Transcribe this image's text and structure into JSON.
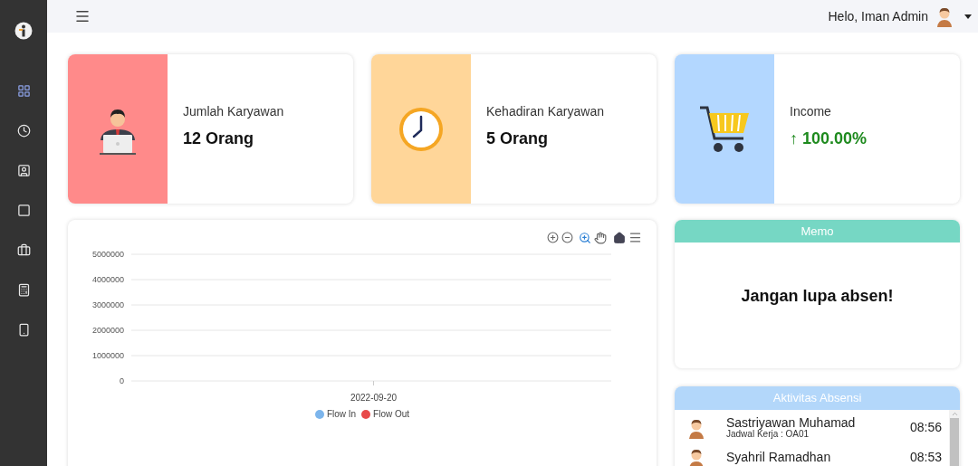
{
  "topbar": {
    "greeting": "Helo, Iman Admin"
  },
  "sidebar": {
    "items": [
      {
        "selected": true
      },
      {
        "selected": false
      },
      {
        "selected": false
      },
      {
        "selected": false
      },
      {
        "selected": false
      },
      {
        "selected": false
      },
      {
        "selected": false
      }
    ]
  },
  "stats": [
    {
      "kind": "employees",
      "label": "Jumlah Karyawan",
      "value": "12 Orang",
      "color": "#ff8a8a"
    },
    {
      "kind": "attendance",
      "label": "Kehadiran Karyawan",
      "value": "5 Orang",
      "color": "#ffd699"
    },
    {
      "kind": "income",
      "label": "Income",
      "value": "↑ 100.00%",
      "color": "#b3d7ff"
    }
  ],
  "chart": {
    "chart_data": {
      "type": "line",
      "grid": true,
      "categories": [
        "2022-09-20"
      ],
      "series": [
        {
          "name": "Flow In",
          "color": "#7cb5ec",
          "values": [
            null
          ]
        },
        {
          "name": "Flow Out",
          "color": "#e84a4a",
          "values": [
            null
          ]
        }
      ],
      "ylim": [
        0,
        5000000
      ],
      "yticks": [
        0,
        1000000,
        2000000,
        3000000,
        4000000,
        5000000
      ]
    }
  },
  "memo": {
    "title": "Memo",
    "text": "Jangan lupa absen!"
  },
  "activity": {
    "title": "Aktivitas Absensi",
    "rows": [
      {
        "name": "Sastriyawan Muhamad",
        "schedule": "Jadwal Kerja : OA01",
        "time": "08:56"
      },
      {
        "name": "Syahril Ramadhan",
        "time": "08:53"
      }
    ]
  }
}
